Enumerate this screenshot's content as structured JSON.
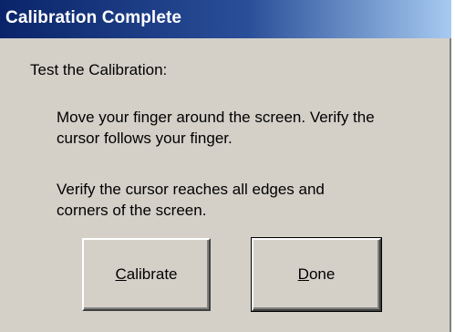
{
  "window": {
    "title": "Calibration Complete"
  },
  "content": {
    "heading": "Test the Calibration:",
    "instruction1_line1": "Move your finger around the screen. Verify the",
    "instruction1_line2": "cursor follows your finger.",
    "instruction2_line1": "Verify the cursor reaches all edges and",
    "instruction2_line2": "corners of the screen."
  },
  "buttons": {
    "calibrate": {
      "mnemonic": "C",
      "rest": "alibrate"
    },
    "done": {
      "mnemonic": "D",
      "rest": "one"
    }
  },
  "colors": {
    "title_bar_start": "#0a246a",
    "title_bar_end": "#a6caf0",
    "dialog_face": "#d4d0c8"
  }
}
